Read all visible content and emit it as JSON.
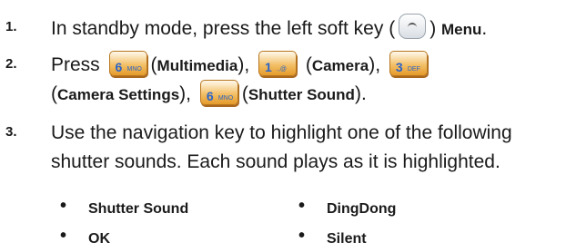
{
  "steps": [
    {
      "number": "1.",
      "lines": [
        {
          "pre": "In standby mode, press the left soft key (",
          "post": ") ",
          "bold": "Menu",
          "end": "."
        }
      ]
    },
    {
      "number": "2.",
      "press": "Press",
      "keys": [
        {
          "digit": "6",
          "letters": "MNO",
          "label": "Multimedia",
          "sep": "),"
        },
        {
          "digit": "1",
          "letters": ".,@",
          "label": "Camera",
          "sep": "),"
        },
        {
          "digit": "3",
          "letters": "DEF",
          "label": "Camera Settings",
          "sep": "),"
        },
        {
          "digit": "6",
          "letters": "MNO",
          "label": "Shutter Sound",
          "sep": ")."
        }
      ]
    },
    {
      "number": "3.",
      "line1": "Use the navigation key to highlight one of the following",
      "line2": "shutter sounds. Each sound plays as it is highlighted."
    }
  ],
  "options": [
    "Shutter Sound",
    "DingDong",
    "OK",
    "Silent"
  ],
  "bullet": "•",
  "colors": {
    "key_fill": "#f3c16a",
    "key_digit": "#2b64c8",
    "text": "#1a1a1a"
  }
}
